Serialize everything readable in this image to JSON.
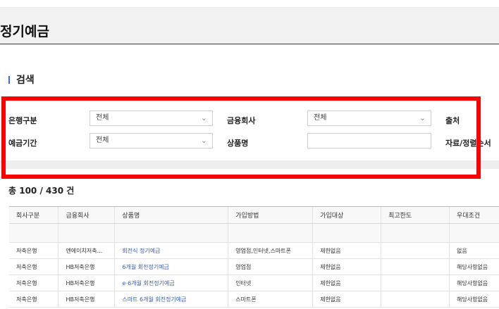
{
  "page": {
    "title": "정기예금"
  },
  "search": {
    "title": "검색",
    "bank_type_label": "은행구분",
    "bank_type_value": "전체",
    "company_label": "금융회사",
    "company_value": "전체",
    "source_label": "출처",
    "period_label": "예금기간",
    "period_value": "전체",
    "product_label": "상품명",
    "product_value": "",
    "sort_label": "자료/정렬순서"
  },
  "results": {
    "count_text": "총 100 / 430 건",
    "columns": [
      "회사구분",
      "금융회사",
      "상품명",
      "가입방법",
      "가입대상",
      "최고한도",
      "우대조건"
    ],
    "rows": [
      [
        "저축은행",
        "엔에이치저축...",
        "회전식 정기예금",
        "영업점,인터넷,스마트폰",
        "제한없음",
        "",
        "없음"
      ],
      [
        "저축은행",
        "HB저축은행",
        "6개월 회전정기예금",
        "영업점",
        "제한없음",
        "",
        "해당사항없음"
      ],
      [
        "저축은행",
        "HB저축은행",
        "e-6개월 회전정기예금",
        "인터넷",
        "제한없음",
        "",
        "해당사항없음"
      ],
      [
        "저축은행",
        "HB저축은행",
        "스마트 6개월 회전정기예금",
        "스마트폰",
        "제한없음",
        "",
        "해당사항없음"
      ]
    ]
  },
  "icons": {
    "dropdown": "chevron-down-icon",
    "section_marker": "section-bar-icon"
  },
  "colors": {
    "accent": "#3a6fd1",
    "highlight_box": "#ff0000",
    "link": "#3b62b8"
  }
}
